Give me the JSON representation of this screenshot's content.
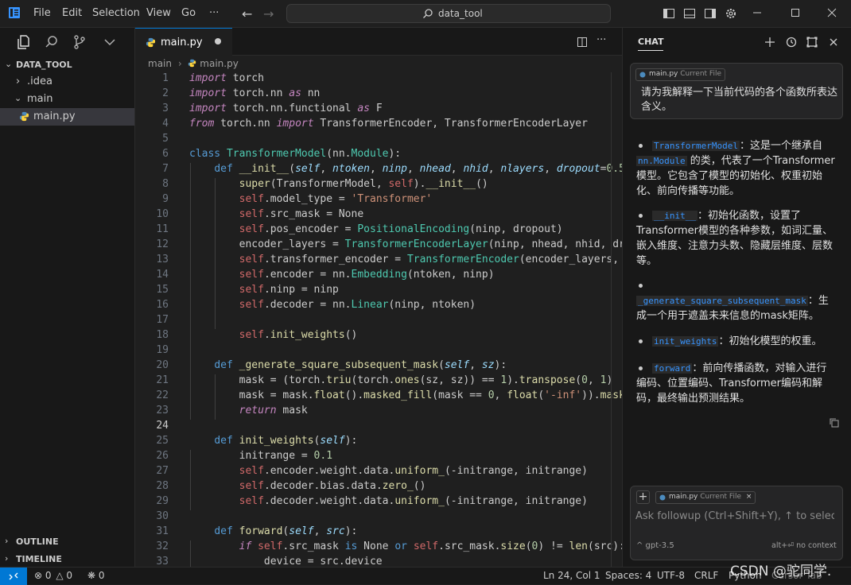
{
  "titlebar": {
    "menu": [
      "File",
      "Edit",
      "Selection",
      "View",
      "Go",
      "···"
    ],
    "search_text": "data_tool"
  },
  "explorer": {
    "title": "DATA_TOOL",
    "items": [
      ".idea",
      "main",
      "main.py"
    ],
    "outline": "OUTLINE",
    "timeline": "TIMELINE"
  },
  "editor": {
    "tab_label": "main.py",
    "breadcrumb": [
      "main",
      "main.py"
    ],
    "current_line": 24
  },
  "chat": {
    "title": "CHAT",
    "file_chip": "main.py",
    "chip_sub": "Current File",
    "user_message": "请为我解释一下当前代码的各个函数所表达含义。",
    "responses": [
      {
        "code": "TransformerModel",
        "pre": "：这是一个继承自 ",
        "code2": "nn.Module",
        "text": " 的类，代表了一个Transformer模型。它包含了模型的初始化、权重初始化、前向传播等功能。"
      },
      {
        "code": "__init__",
        "pre": "",
        "code2": "",
        "text": "：初始化函数，设置了Transformer模型的各种参数，如词汇量、嵌入维度、注意力头数、隐藏层维度、层数等。"
      },
      {
        "code": "_generate_square_subsequent_mask",
        "pre": "",
        "code2": "",
        "text": "：生成一个用于遮盖未来信息的mask矩阵。"
      },
      {
        "code": "init_weights",
        "pre": "",
        "code2": "",
        "text": "：初始化模型的权重。"
      },
      {
        "code": "forward",
        "pre": "",
        "code2": "",
        "text": "：前向传播函数，对输入进行编码、位置编码、Transformer编码和解码，最终输出预测结果。"
      }
    ],
    "input_placeholder": "Ask followup (Ctrl+Shift+Y), ↑ to select",
    "model": "^ gpt-3.5",
    "no_context": "alt+⏎ no context"
  },
  "statusbar": {
    "errors": "0",
    "warnings": "0",
    "ports": "0",
    "position": "Ln 24, Col 1",
    "spaces": "Spaces: 4",
    "encoding": "UTF-8",
    "eol": "CRLF",
    "language": "Python",
    "cursor_tab": "Cursor Tab"
  },
  "watermark": "CSDN @驼同学."
}
